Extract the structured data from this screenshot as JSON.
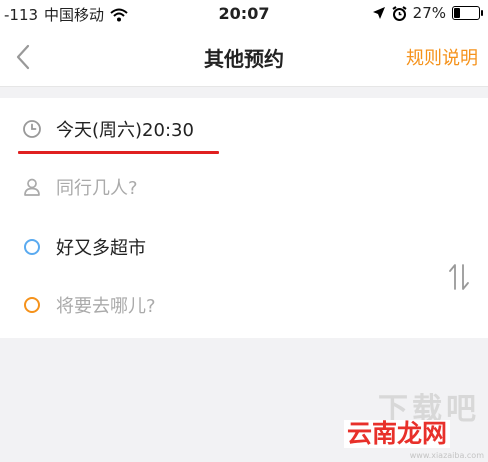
{
  "status": {
    "signal": "-113",
    "carrier": "中国移动",
    "time": "20:07",
    "battery": "27%",
    "battery_level": 0.27
  },
  "nav": {
    "title": "其他预约",
    "rules_label": "规则说明"
  },
  "form": {
    "time": "今天(周六)20:30",
    "people_placeholder": "同行几人?",
    "origin": "好又多超市",
    "destination_placeholder": "将要去哪儿?"
  },
  "colors": {
    "accent_orange": "#f5921b",
    "origin_blue": "#5aaaf0",
    "highlight_red": "#e02020"
  },
  "watermark": {
    "top": "下载吧",
    "brand": "云南龙网",
    "domain": "www.xiazaiba.com"
  }
}
